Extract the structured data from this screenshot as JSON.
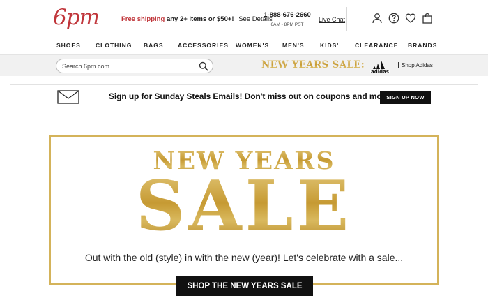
{
  "header": {
    "logo": "6pm",
    "promo": {
      "free_shipping": "Free shipping",
      "condition": "any 2+ items or $50+!",
      "details_link": "See Details"
    },
    "phone": {
      "number": "1-888-676-2660",
      "hours": "6AM - 8PM PST"
    },
    "live_chat": "Live Chat",
    "icons": [
      "user-icon",
      "help-icon",
      "heart-icon",
      "shopping-bag-icon"
    ]
  },
  "nav": {
    "items": [
      "SHOES",
      "CLOTHING",
      "BAGS",
      "ACCESSORIES",
      "WOMEN'S",
      "MEN'S",
      "KIDS'",
      "CLEARANCE",
      "BRANDS"
    ]
  },
  "search": {
    "placeholder": "Search 6pm.com",
    "value": ""
  },
  "sale_banner": {
    "text": "NEW YEARS SALE:",
    "brand_logo": "adidas-logo",
    "shop_link": "Shop Adidas"
  },
  "email_signup": {
    "text": "Sign up for Sunday Steals Emails! Don't miss out on coupons and more.",
    "button": "SIGN UP NOW"
  },
  "hero": {
    "headline": "NEW YEARS",
    "big": "SALE",
    "subtitle": "Out with the old (style) in with the new (year)! Let's celebrate with a sale...",
    "button": "SHOP THE NEW YEARS SALE"
  },
  "colors": {
    "brand_red": "#c0353a",
    "gold": "#c9a23c",
    "button_black": "#111111"
  }
}
